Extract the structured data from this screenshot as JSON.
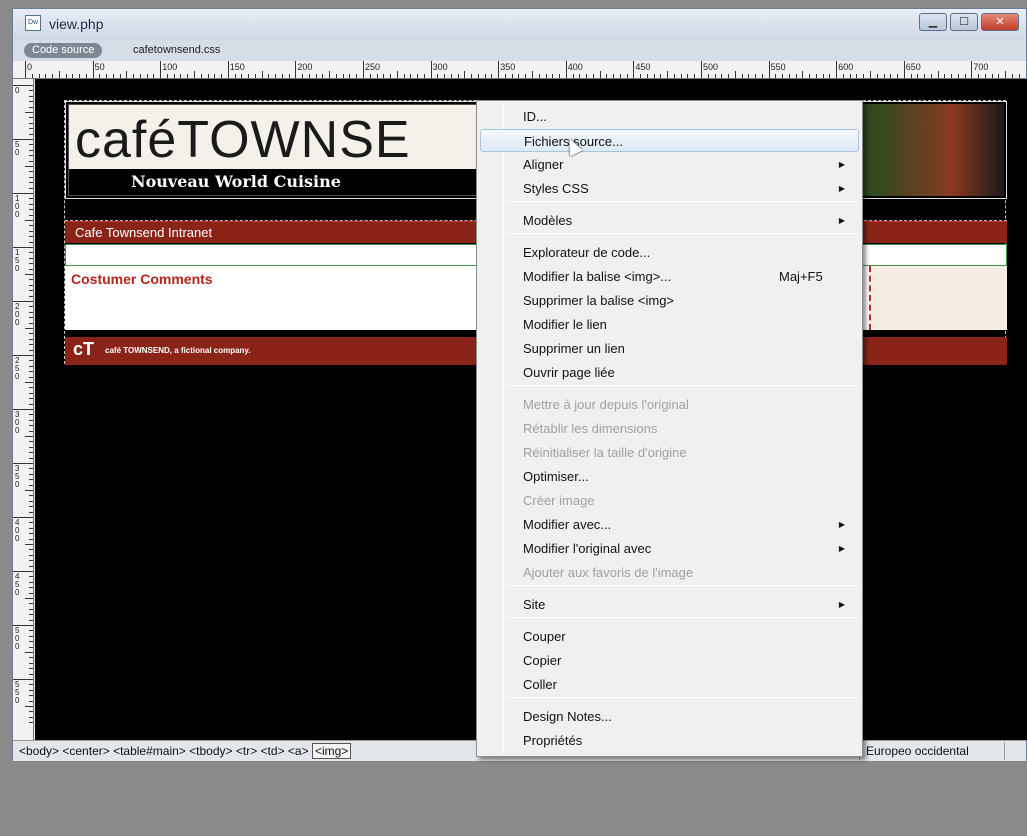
{
  "window": {
    "title": "view.php",
    "app_icon": "Dw",
    "min_icon": "window-minimize-icon",
    "max_icon": "window-maximize-icon",
    "close_icon": "window-close-icon"
  },
  "file_tabs": {
    "source_tab": "Code source",
    "related_file": "cafetownsend.css"
  },
  "ruler": {
    "h_labels": [
      "0",
      "50",
      "100",
      "150",
      "200",
      "250",
      "300",
      "350",
      "400",
      "450",
      "500",
      "550",
      "600",
      "650",
      "700"
    ],
    "v_labels": [
      "0",
      "50",
      "100",
      "150",
      "200",
      "250",
      "300",
      "350",
      "400",
      "450",
      "500",
      "550"
    ]
  },
  "page": {
    "logo_text": "caféTOWNSE",
    "tagline": "Nouveau World Cuisine",
    "intranet_title": "Cafe Townsend Intranet",
    "comments_title": "Costumer Comments",
    "footer_logo": "cT",
    "footer_text": "café TOWNSEND, a fictional company."
  },
  "status": {
    "tag_path": [
      "<body>",
      "<center>",
      "<table#main>",
      "<tbody>",
      "<tr>",
      "<td>",
      "<a>"
    ],
    "selected_tag": "<img>",
    "encoding": "Europeo occidental"
  },
  "context_menu": {
    "items": [
      {
        "label": "ID...",
        "enabled": true
      },
      {
        "label": "Fichiers source...",
        "enabled": true,
        "hover": true
      },
      {
        "label": "Aligner",
        "enabled": true,
        "submenu": true
      },
      {
        "label": "Styles CSS",
        "enabled": true,
        "submenu": true
      },
      {
        "label": "Modèles",
        "enabled": true,
        "submenu": true
      },
      {
        "label": "Explorateur de code...",
        "enabled": true
      },
      {
        "label": "Modifier la balise <img>...",
        "enabled": true,
        "shortcut": "Maj+F5"
      },
      {
        "label": "Supprimer la balise <img>",
        "enabled": true
      },
      {
        "label": "Modifier le lien",
        "enabled": true
      },
      {
        "label": "Supprimer un lien",
        "enabled": true
      },
      {
        "label": "Ouvrir page liée",
        "enabled": true
      },
      {
        "label": "Mettre à jour depuis l'original",
        "enabled": false
      },
      {
        "label": "Rétablir les dimensions",
        "enabled": false
      },
      {
        "label": "Réinitialiser la taille d'origine",
        "enabled": false
      },
      {
        "label": "Optimiser...",
        "enabled": true
      },
      {
        "label": "Créer image",
        "enabled": false
      },
      {
        "label": "Modifier avec...",
        "enabled": true,
        "submenu": true
      },
      {
        "label": "Modifier l'original avec",
        "enabled": true,
        "submenu": true
      },
      {
        "label": "Ajouter aux favoris de l'image",
        "enabled": false
      },
      {
        "label": "Site",
        "enabled": true,
        "submenu": true
      },
      {
        "label": "Couper",
        "enabled": true
      },
      {
        "label": "Copier",
        "enabled": true
      },
      {
        "label": "Coller",
        "enabled": true
      },
      {
        "label": "Design Notes...",
        "enabled": true
      },
      {
        "label": "Propriétés",
        "enabled": true
      }
    ],
    "arrow_icon": "submenu-arrow-icon"
  },
  "colors": {
    "brand_red": "#8b2418",
    "comments_red": "#b2261a",
    "menu_hover": "#dde9f5"
  }
}
